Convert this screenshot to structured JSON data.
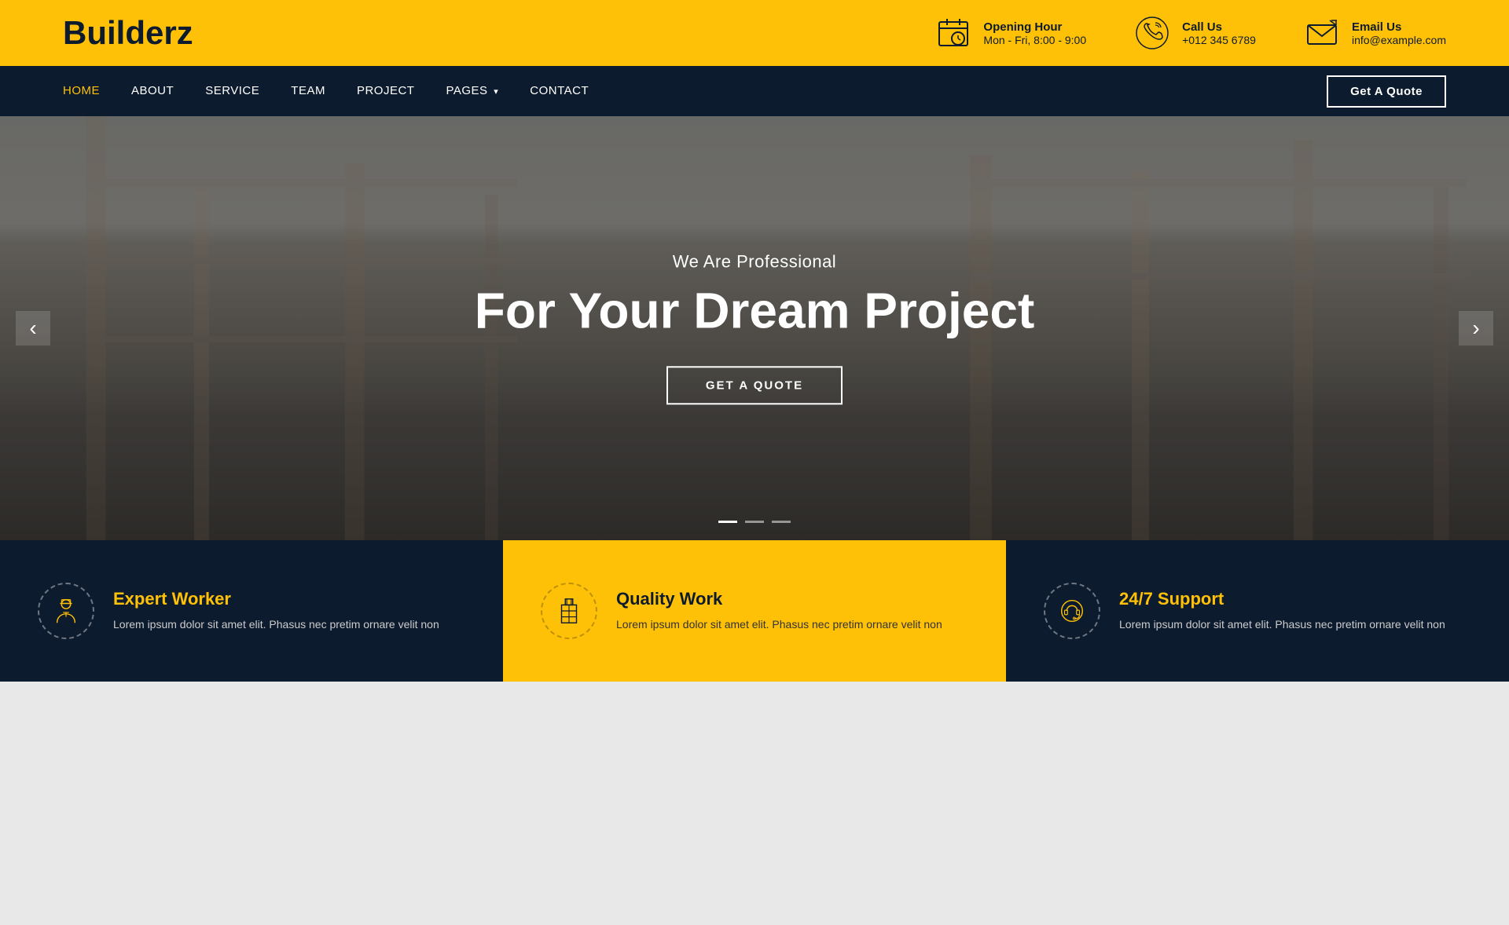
{
  "brand": {
    "name": "Builderz"
  },
  "topbar": {
    "items": [
      {
        "icon": "calendar-clock-icon",
        "label": "Opening Hour",
        "value": "Mon - Fri, 8:00 - 9:00"
      },
      {
        "icon": "phone-icon",
        "label": "Call Us",
        "value": "+012 345 6789"
      },
      {
        "icon": "email-icon",
        "label": "Email Us",
        "value": "info@example.com"
      }
    ]
  },
  "navbar": {
    "links": [
      {
        "label": "HOME",
        "active": true,
        "has_dropdown": false
      },
      {
        "label": "ABOUT",
        "active": false,
        "has_dropdown": false
      },
      {
        "label": "SERVICE",
        "active": false,
        "has_dropdown": false
      },
      {
        "label": "TEAM",
        "active": false,
        "has_dropdown": false
      },
      {
        "label": "PROJECT",
        "active": false,
        "has_dropdown": false
      },
      {
        "label": "PAGES",
        "active": false,
        "has_dropdown": true
      },
      {
        "label": "CONTACT",
        "active": false,
        "has_dropdown": false
      }
    ],
    "cta_label": "Get A Quote"
  },
  "hero": {
    "subtitle": "We Are Professional",
    "title": "For Your Dream Project",
    "cta_label": "GET A QUOTE",
    "dots": [
      {
        "active": true
      },
      {
        "active": false
      },
      {
        "active": false
      }
    ]
  },
  "features": [
    {
      "icon": "worker-icon",
      "title": "Expert Worker",
      "description": "Lorem ipsum dolor sit amet elit. Phasus nec pretim ornare velit non"
    },
    {
      "icon": "building-icon",
      "title": "Quality Work",
      "description": "Lorem ipsum dolor sit amet elit. Phasus nec pretim ornare velit non"
    },
    {
      "icon": "support-icon",
      "title": "24/7 Support",
      "description": "Lorem ipsum dolor sit amet elit. Phasus nec pretim ornare velit non"
    }
  ]
}
